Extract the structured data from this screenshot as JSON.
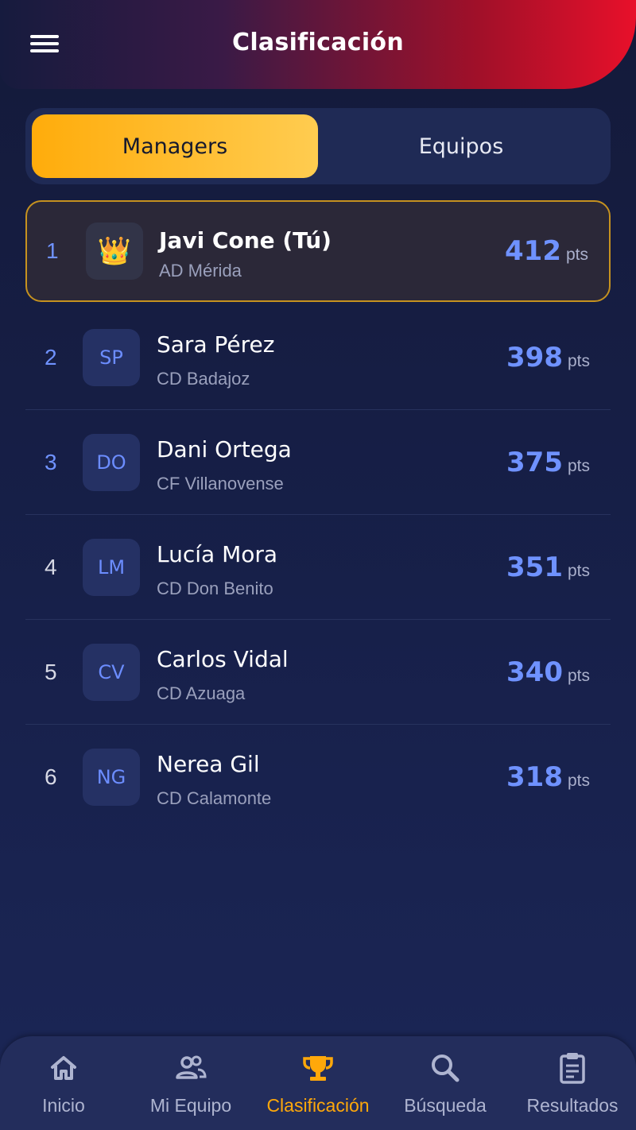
{
  "header": {
    "title": "Clasificación"
  },
  "tabs": [
    {
      "label": "Managers",
      "active": true
    },
    {
      "label": "Equipos",
      "active": false
    }
  ],
  "leaderboard": [
    {
      "rank": "1",
      "avatar": "crown-icon",
      "name": "Javi Cone (Tú)",
      "club": "AD Mérida",
      "points": "412",
      "unit": "pts",
      "is_me": true
    },
    {
      "rank": "2",
      "avatar": "SP",
      "name": "Sara Pérez",
      "club": "CD Badajoz",
      "points": "398",
      "unit": "pts"
    },
    {
      "rank": "3",
      "avatar": "DO",
      "name": "Dani Ortega",
      "club": "CF Villanovense",
      "points": "375",
      "unit": "pts"
    },
    {
      "rank": "4",
      "avatar": "LM",
      "name": "Lucía Mora",
      "club": "CD Don Benito",
      "points": "351",
      "unit": "pts"
    },
    {
      "rank": "5",
      "avatar": "CV",
      "name": "Carlos Vidal",
      "club": "CD Azuaga",
      "points": "340",
      "unit": "pts"
    },
    {
      "rank": "6",
      "avatar": "NG",
      "name": "Nerea Gil",
      "club": "CD Calamonte",
      "points": "318",
      "unit": "pts"
    }
  ],
  "bottom_nav": [
    {
      "label": "Inicio",
      "icon": "home-icon",
      "active": false
    },
    {
      "label": "Mi Equipo",
      "icon": "people-icon",
      "active": false
    },
    {
      "label": "Clasificación",
      "icon": "trophy-icon",
      "active": true
    },
    {
      "label": "Búsqueda",
      "icon": "search-icon",
      "active": false
    },
    {
      "label": "Resultados",
      "icon": "clipboard-icon",
      "active": false
    }
  ],
  "colors": {
    "accent": "#ffac0b",
    "points": "#6f92ff",
    "header_red": "#e8102a"
  }
}
